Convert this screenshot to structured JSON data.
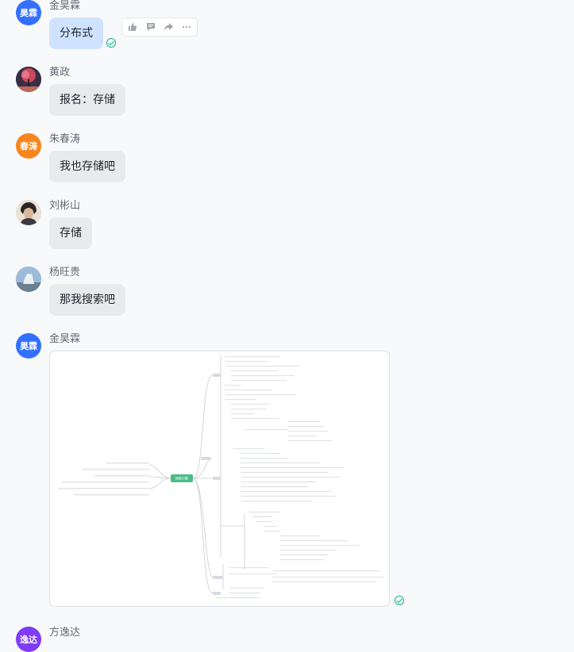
{
  "messages": [
    {
      "sender": "金昊霖",
      "avatar_text": "昊霖",
      "text": "分布式"
    },
    {
      "sender": "黄政",
      "text": "报名：存储"
    },
    {
      "sender": "朱春涛",
      "avatar_text": "春涛",
      "text": "我也存储吧"
    },
    {
      "sender": "刘彬山",
      "text": "存储"
    },
    {
      "sender": "杨旺贵",
      "text": "那我搜索吧"
    },
    {
      "sender": "金昊霖",
      "avatar_text": "昊霖"
    },
    {
      "sender": "方逸达",
      "avatar_text": "逸达"
    }
  ],
  "toolbar": {
    "icons": [
      "thumbs-up-icon",
      "comment-icon",
      "forward-icon",
      "more-icon"
    ]
  },
  "mindmap": {
    "center_label": "搜索引擎",
    "branch_labels": [
      "",
      "",
      "",
      "",
      "",
      "",
      "",
      "",
      ""
    ]
  },
  "colors": {
    "accent_blue": "#3370ff",
    "orange": "#f7861e",
    "purple": "#7f3bf5",
    "read_green": "#15b08e",
    "my_bubble": "#cfe2ff",
    "other_bubble": "#e9eaec",
    "mindmap_center": "#4dbb85"
  }
}
